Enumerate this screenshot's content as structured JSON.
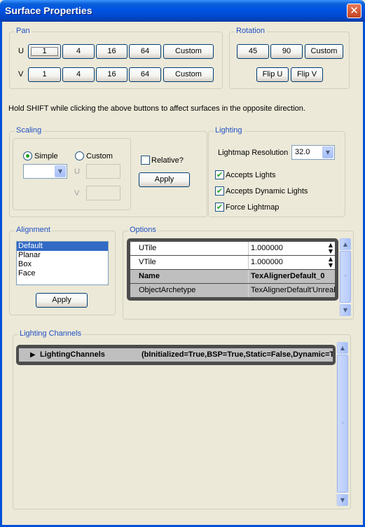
{
  "window": {
    "title": "Surface Properties",
    "close_glyph": "✕"
  },
  "pan": {
    "label": "Pan",
    "u_label": "U",
    "v_label": "V",
    "u_buttons": [
      "1",
      "4",
      "16",
      "64",
      "Custom"
    ],
    "v_buttons": [
      "1",
      "4",
      "16",
      "64",
      "Custom"
    ]
  },
  "rotation": {
    "label": "Rotation",
    "buttons": [
      "45",
      "90",
      "Custom"
    ],
    "flip_u": "Flip U",
    "flip_v": "Flip V"
  },
  "hint": "Hold SHIFT while clicking the above buttons to affect surfaces in the opposite direction.",
  "scaling": {
    "label": "Scaling",
    "simple_label": "Simple",
    "custom_label": "Custom",
    "simple_selected": true,
    "u_label": "U",
    "v_label": "V",
    "relative_label": "Relative?",
    "relative_checked": false,
    "apply_label": "Apply"
  },
  "lighting": {
    "label": "Lighting",
    "lightmap_label": "Lightmap Resolution",
    "lightmap_value": "32.0",
    "accepts_lights": "Accepts Lights",
    "accepts_dynamic": "Accepts Dynamic Lights",
    "force_lightmap": "Force Lightmap",
    "accepts_lights_checked": true,
    "accepts_dynamic_checked": true,
    "force_lightmap_checked": true
  },
  "alignment": {
    "label": "Alignment",
    "items": [
      "Default",
      "Planar",
      "Box",
      "Face"
    ],
    "selected": "Default",
    "apply_label": "Apply"
  },
  "options": {
    "label": "Options",
    "rows": [
      {
        "name": "UTile",
        "value": "1.000000",
        "bold": false
      },
      {
        "name": "VTile",
        "value": "1.000000",
        "bold": false
      },
      {
        "name": "Name",
        "value": "TexAlignerDefault_0",
        "bold": true
      },
      {
        "name": "ObjectArchetype",
        "value": "TexAlignerDefault'UnrealEd.Default__TexAlignerDefault'",
        "bold": false
      }
    ]
  },
  "lighting_channels": {
    "label": "Lighting Channels",
    "row_name": "LightingChannels",
    "row_value": "(bInitialized=True,BSP=True,Static=False,Dynamic=True)"
  },
  "icons": {
    "arrow_up": "▲",
    "arrow_down": "▼",
    "expand": "▶",
    "check": "✔"
  }
}
